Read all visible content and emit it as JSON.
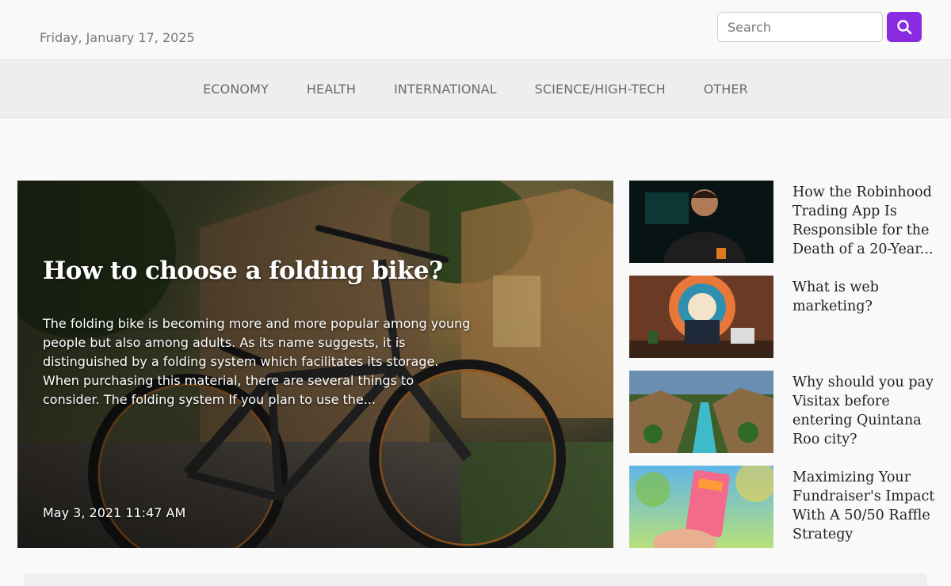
{
  "header": {
    "date": "Friday, January 17, 2025",
    "search_placeholder": "Search",
    "search_icon": "search-icon",
    "accent_color": "#8a2be2"
  },
  "nav": {
    "items": [
      "ECONOMY",
      "HEALTH",
      "INTERNATIONAL",
      "SCIENCE/HIGH-TECH",
      "OTHER"
    ]
  },
  "hero": {
    "title": "How to choose a folding bike?",
    "excerpt": "The folding bike is becoming more and more popular among young people but also among adults. As its name suggests, it is distinguished by a folding system which facilitates its storage. When purchasing this material, there are several things to consider. The folding system If you plan to use the...",
    "date": "May 3, 2021 11:47 AM"
  },
  "side_articles": [
    {
      "title": "How the Robinhood Trading App Is Responsible for the Death of a 20-Year..."
    },
    {
      "title": "What is web marketing?"
    },
    {
      "title": "Why should you pay Visitax before entering Quintana Roo city?"
    },
    {
      "title": "Maximizing Your Fundraiser's Impact With A 50/50 Raffle Strategy"
    }
  ]
}
